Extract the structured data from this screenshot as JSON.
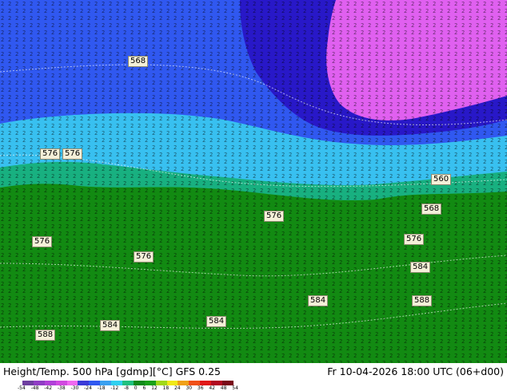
{
  "map": {
    "title": "Height/Temp. 500 hPa [gdmp][°C]",
    "model": "GFS 0.25",
    "valid_time": "Fr 10-04-2026 18:00 UTC (06+d00)",
    "contour_labels": [
      "568",
      "576",
      "576",
      "560",
      "568",
      "576",
      "576",
      "576",
      "576",
      "584",
      "584",
      "588",
      "584",
      "584",
      "588"
    ],
    "colorbar": {
      "ticks": [
        "-54",
        "-48",
        "-42",
        "-38",
        "-30",
        "-24",
        "-18",
        "-12",
        "-8",
        "0",
        "6",
        "12",
        "18",
        "24",
        "30",
        "36",
        "42",
        "48",
        "54"
      ],
      "colors": [
        "#6e3fa0",
        "#8f3cc4",
        "#b03fd8",
        "#d149e0",
        "#f069f0",
        "#3a3ad8",
        "#2f58f0",
        "#3aa0f0",
        "#30d0f0",
        "#20c080",
        "#0f8a1a",
        "#18a018",
        "#a0d818",
        "#f0e818",
        "#f0a018",
        "#f05018",
        "#e01818",
        "#b00820",
        "#780818"
      ]
    },
    "regions": {
      "magenta": "#e060f0",
      "deep_blue": "#2818c8",
      "blue": "#3058f0",
      "cyan": "#38c0f0",
      "teal": "#18b080",
      "green": "#128a12"
    }
  }
}
